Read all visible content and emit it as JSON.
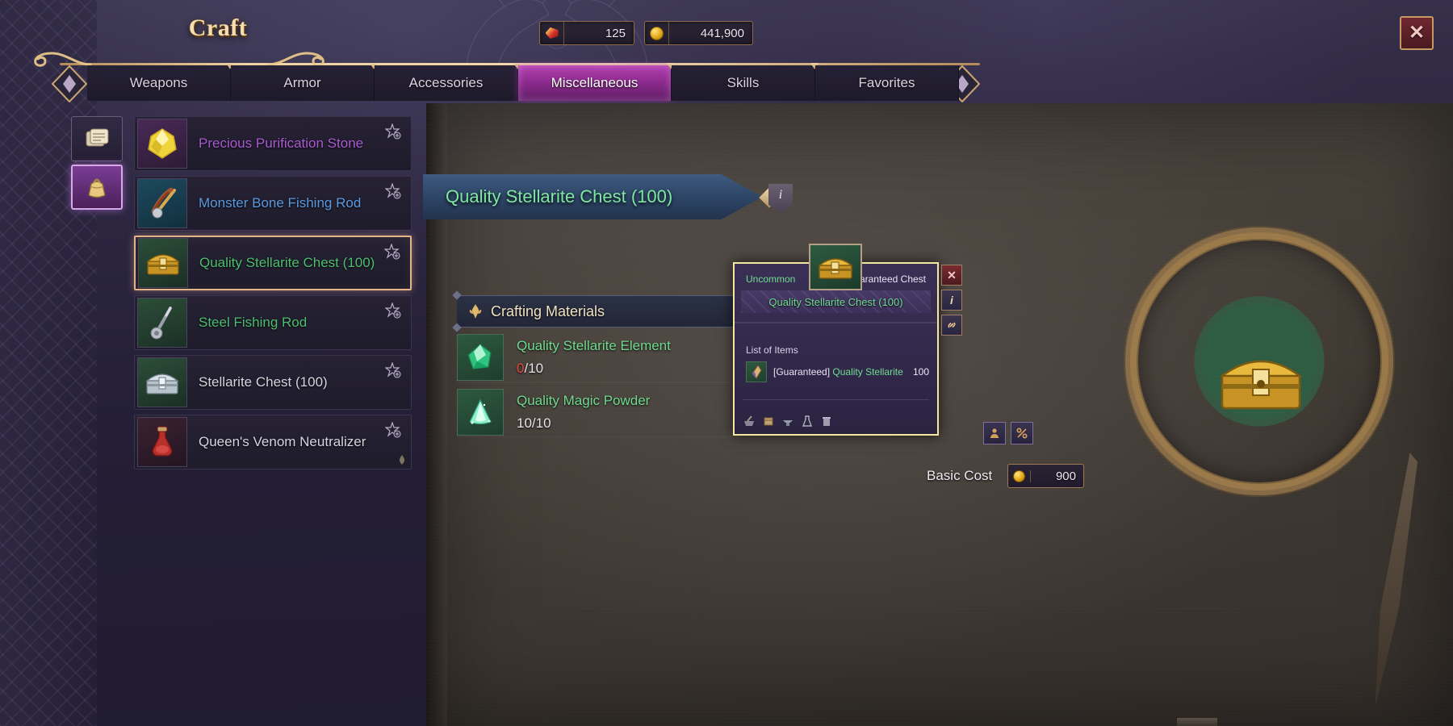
{
  "window": {
    "title": "Craft",
    "close_label": "✕"
  },
  "currencies": [
    {
      "icon": "gem-icon",
      "value": "125"
    },
    {
      "icon": "gold-coin-icon",
      "value": "441,900"
    }
  ],
  "tabs": [
    {
      "label": "Weapons",
      "active": false
    },
    {
      "label": "Armor",
      "active": false
    },
    {
      "label": "Accessories",
      "active": false
    },
    {
      "label": "Miscellaneous",
      "active": true
    },
    {
      "label": "Skills",
      "active": false
    },
    {
      "label": "Favorites",
      "active": false
    }
  ],
  "category_icons": [
    {
      "name": "scroll-icon",
      "active": false
    },
    {
      "name": "pouch-icon",
      "active": true
    }
  ],
  "item_list": [
    {
      "name": "Precious Purification Stone",
      "rarity_color": "#a95bd1",
      "icon": "yellow-gem-icon",
      "selected": false,
      "favorited": false
    },
    {
      "name": "Monster Bone Fishing Rod",
      "rarity_color": "#5b9ae0",
      "icon": "feather-rod-icon",
      "selected": false,
      "favorited": false
    },
    {
      "name": "Quality Stellarite Chest (100)",
      "rarity_color": "#4bbf6e",
      "icon": "gold-chest-icon",
      "selected": true,
      "favorited": false
    },
    {
      "name": "Steel Fishing Rod",
      "rarity_color": "#4bbf6e",
      "icon": "steel-rod-icon",
      "selected": false,
      "favorited": false
    },
    {
      "name": "Stellarite Chest (100)",
      "rarity_color": "#d8d3e0",
      "icon": "silver-chest-icon",
      "selected": false,
      "favorited": false
    },
    {
      "name": "Queen's Venom Neutralizer",
      "rarity_color": "#d8d3e0",
      "icon": "red-flask-icon",
      "selected": false,
      "favorited": false
    }
  ],
  "detail": {
    "banner_title": "Quality Stellarite Chest (100)",
    "info_glyph": "i",
    "materials_header": "Crafting Materials",
    "materials": [
      {
        "name": "Quality Stellarite Element",
        "have": "0",
        "need": "10",
        "separator": "/",
        "satisfied": false,
        "icon": "green-crystal-icon"
      },
      {
        "name": "Quality Magic Powder",
        "have": "10",
        "need": "10",
        "separator": "/",
        "satisfied": true,
        "icon": "green-powder-icon"
      }
    ],
    "basic_cost_label": "Basic Cost",
    "basic_cost_value": "900",
    "basic_cost_icon": "gold-coin-icon"
  },
  "tooltip": {
    "rarity": "Uncommon",
    "subtype": "Guaranteed Chest",
    "item_name": "Quality Stellarite Chest (100)",
    "list_label": "List of Items",
    "entries": [
      {
        "prefix": "[Guaranteed]",
        "name": "Quality Stellarite",
        "qty": "100",
        "icon": "stellarite-shard-icon"
      }
    ],
    "footer_icons": [
      "mortar-icon",
      "crate-icon",
      "anvil-icon",
      "flask-icon",
      "trash-icon"
    ],
    "side_buttons": [
      {
        "name": "close-icon",
        "glyph": "✕",
        "style": "red"
      },
      {
        "name": "info-icon",
        "glyph": "i",
        "style": "dark"
      },
      {
        "name": "link-icon",
        "glyph": "🔗",
        "style": "dark"
      }
    ]
  },
  "right_buttons": [
    {
      "name": "compare-icon",
      "glyph": "⚖"
    },
    {
      "name": "percent-icon",
      "glyph": "%"
    }
  ],
  "colors": {
    "accent_gold": "#f3d9ae",
    "tab_active": "#8c2b8e",
    "rarity_green": "#4bbf6e",
    "rarity_blue": "#5b9ae0",
    "rarity_purple": "#a95bd1",
    "warning_red": "#e04b3f"
  }
}
